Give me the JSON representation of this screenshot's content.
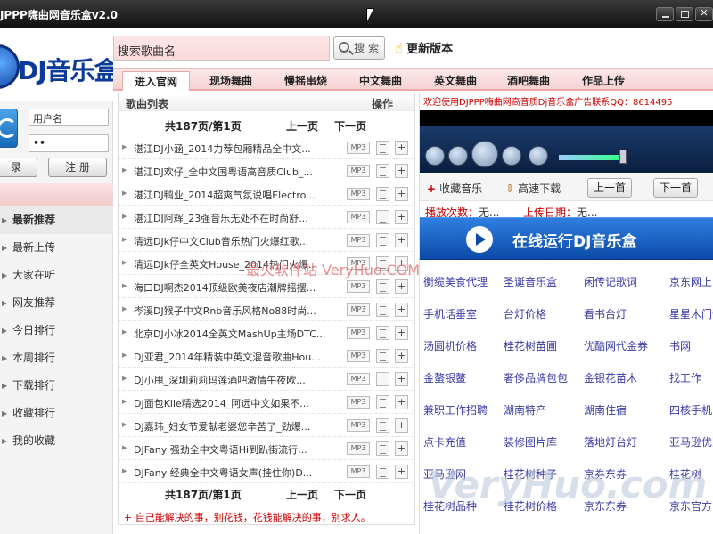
{
  "window": {
    "title": "JPPP嗨曲网音乐盒v2.0"
  },
  "brand": {
    "logo_text": "DJ音乐盒"
  },
  "login": {
    "username_placeholder": "用户名",
    "password_value": "••",
    "login_label": "录",
    "register_label": "注 册"
  },
  "sidebar": {
    "items": [
      {
        "label": "最新推荐"
      },
      {
        "label": "最新上传"
      },
      {
        "label": "大家在听"
      },
      {
        "label": "网友推荐"
      },
      {
        "label": "今日排行"
      },
      {
        "label": "本周排行"
      },
      {
        "label": "下载排行"
      },
      {
        "label": "收藏排行"
      },
      {
        "label": "我的收藏"
      }
    ]
  },
  "search": {
    "placeholder": "搜索歌曲名",
    "button_label": "搜 索",
    "update_label": "更新版本"
  },
  "tabs": [
    {
      "label": "进入官网"
    },
    {
      "label": "现场舞曲"
    },
    {
      "label": "慢摇串烧"
    },
    {
      "label": "中文舞曲"
    },
    {
      "label": "英文舞曲"
    },
    {
      "label": "酒吧舞曲"
    },
    {
      "label": "作品上传"
    }
  ],
  "songlist": {
    "header_title": "歌曲列表",
    "header_action": "操作",
    "pager": {
      "text": "共187页/第1页",
      "prev": "上一页",
      "next": "下一页"
    },
    "mp3_label": "MP3",
    "rows": [
      {
        "name": "湛江DJ小涵_2014力荐包厢精品全中文..."
      },
      {
        "name": "湛江DJ欢仔_全中文国粤语高音质Club_..."
      },
      {
        "name": "湛江DJ鸭业_2014超爽气氛说唱Electro..."
      },
      {
        "name": "湛江DJ阿辉_23强音乐无处不在时尚舒..."
      },
      {
        "name": "清远DJk仔中文Club音乐热门火爆红歌..."
      },
      {
        "name": "清远DJk仔全英文House_2014热门火爆..."
      },
      {
        "name": "海口DJ啊杰2014顶级欧美夜店潮牌摇摆..."
      },
      {
        "name": "岑溪DJ猴子中文Rnb音乐风格No88时尚..."
      },
      {
        "name": "北京DJ小冰2014全英文MashUp主场DTC..."
      },
      {
        "name": "DJ亚君_2014年精装中英文混音歌曲Hou..."
      },
      {
        "name": "DJ小甩_深圳莉莉玛莲酒吧激情午夜欧..."
      },
      {
        "name": "DJ面包Kile精选2014_阿远中文如果不..."
      },
      {
        "name": "DJ嘉玮_妇女节爱献老婆您辛苦了_劲爆..."
      },
      {
        "name": "DJFany 强劲全中文粤语Hi到趴街流行..."
      },
      {
        "name": "DJFany 经典全中文粤语女声(挂住你)D..."
      }
    ],
    "footer_note": "+ 自己能解决的事，别花钱，花钱能解决的事，别求人。"
  },
  "right": {
    "ticker": "欢迎使用DJPPP嗨曲网高音质Dj音乐盒广告联系QQ：8614495",
    "controls": {
      "favorite": "收藏音乐",
      "download": "高速下载",
      "prev": "上一首",
      "next": "下一首"
    },
    "play_count_label": "播放次数：",
    "play_count_value": "无...",
    "upload_date_label": "上传日期：",
    "upload_date_value": "无...",
    "online_button": "在线运行DJ音乐盒",
    "ads": [
      [
        "衡缆美食代理",
        "圣诞音乐盒",
        "闲传记歌词",
        "京东网上"
      ],
      [
        "手机话垂室",
        "台灯价格",
        "看书台灯",
        "星星木门价"
      ],
      [
        "汤圆机价格",
        "桂花树苗圃",
        "优酷网代金券",
        "书网"
      ],
      [
        "金螯银鳌",
        "奢侈品牌包包",
        "金银花苗木",
        "找工作"
      ],
      [
        "兼职工作招聘",
        "湖南特产",
        "湖南住宿",
        "四核手机"
      ],
      [
        "点卡充值",
        "装修图片库",
        "落地灯台灯",
        "亚马逊优惠"
      ],
      [
        "亚马逊网",
        "桂花树种子",
        "京券东券",
        "桂花树"
      ],
      [
        "桂花树品种",
        "桂花树价格",
        "京东东券",
        "京东官方"
      ]
    ]
  },
  "watermarks": {
    "center": "最火软件站 VeryHuo.COM",
    "corner": "VeryHuo.com"
  },
  "colors": {
    "accent_red": "#cc0000",
    "tab_pink": "#f6d3d3",
    "player_blue": "#0c4aa8",
    "link_blue": "#3a3aa5"
  }
}
